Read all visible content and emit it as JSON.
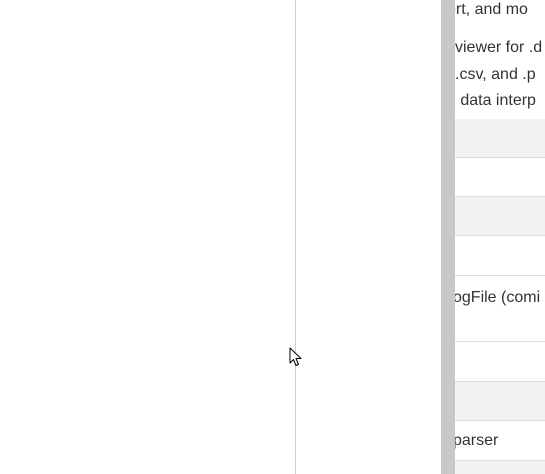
{
  "document": {
    "lines": [
      "ort, and mo",
      "viewer for .d",
      ".csv, and .p",
      "n data interp"
    ]
  },
  "table": {
    "rows": [
      {
        "text": "",
        "shaded": true
      },
      {
        "text": "",
        "shaded": false
      },
      {
        "text": "",
        "shaded": true
      },
      {
        "text": "",
        "shaded": false
      },
      {
        "text": "ogFile (comi",
        "shaded": false
      },
      {
        "text": "",
        "shaded": false
      },
      {
        "text": "",
        "shaded": true
      },
      {
        "text": "parser",
        "shaded": false
      },
      {
        "text": "",
        "shaded": true
      }
    ]
  },
  "icons": {
    "cursor": "mouse-pointer-icon"
  },
  "colors": {
    "splitter": "#cfcfcf",
    "scrollbar": "#c8c8c8",
    "row_shade": "#f2f2f2",
    "text": "#333333"
  }
}
